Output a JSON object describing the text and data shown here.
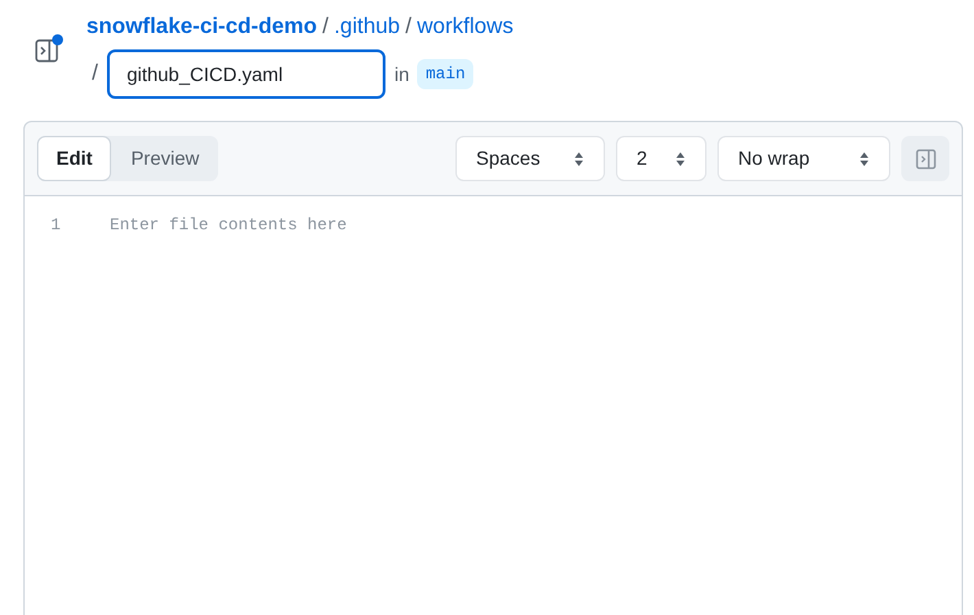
{
  "breadcrumb": {
    "repo": "snowflake-ci-cd-demo",
    "path": [
      {
        "sep": "/",
        "name": ".github"
      },
      {
        "sep": "/",
        "name": "workflows"
      }
    ],
    "file_sep": "/",
    "filename": "github_CICD.yaml",
    "in_label": "in",
    "branch": "main"
  },
  "tabs": [
    {
      "label": "Edit",
      "selected": true
    },
    {
      "label": "Preview",
      "selected": false
    }
  ],
  "selects": [
    {
      "value": "Spaces"
    },
    {
      "value": "2"
    },
    {
      "value": "No wrap"
    }
  ],
  "editor": {
    "line_numbers": [
      "1"
    ],
    "placeholder": "Enter file contents here"
  }
}
